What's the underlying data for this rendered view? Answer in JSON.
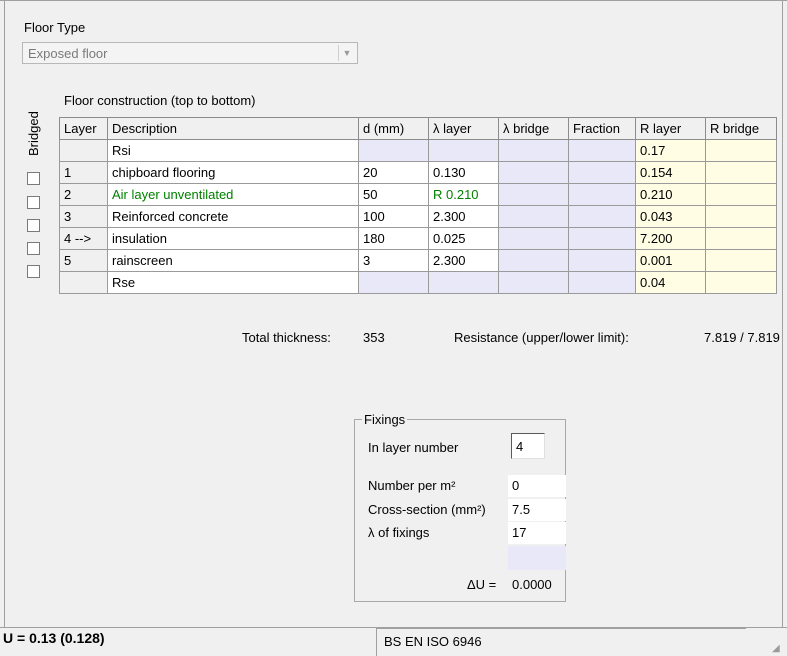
{
  "floor_type": {
    "label": "Floor Type",
    "value": "Exposed floor"
  },
  "construction": {
    "label": "Floor construction (top to bottom)",
    "bridged_label": "Bridged",
    "columns": [
      "Layer",
      "Description",
      "d (mm)",
      "λ layer",
      "λ bridge",
      "Fraction",
      "R layer",
      "R bridge"
    ],
    "rows": [
      {
        "layer": "",
        "description": "Rsi",
        "d": "",
        "lambda": "",
        "lambda_bridge": "",
        "fraction": "",
        "r_layer": "0.17",
        "r_bridge": ""
      },
      {
        "layer": "1",
        "description": "chipboard flooring",
        "d": "20",
        "lambda": "0.130",
        "lambda_bridge": "",
        "fraction": "",
        "r_layer": "0.154",
        "r_bridge": ""
      },
      {
        "layer": "2",
        "description": "Air layer unventilated",
        "d": "50",
        "lambda": "R 0.210",
        "lambda_bridge": "",
        "fraction": "",
        "r_layer": "0.210",
        "r_bridge": ""
      },
      {
        "layer": "3",
        "description": "Reinforced concrete",
        "d": "100",
        "lambda": "2.300",
        "lambda_bridge": "",
        "fraction": "",
        "r_layer": "0.043",
        "r_bridge": ""
      },
      {
        "layer": "4 -->",
        "description": "insulation",
        "d": "180",
        "lambda": "0.025",
        "lambda_bridge": "",
        "fraction": "",
        "r_layer": "7.200",
        "r_bridge": ""
      },
      {
        "layer": "5",
        "description": "rainscreen",
        "d": "3",
        "lambda": "2.300",
        "lambda_bridge": "",
        "fraction": "",
        "r_layer": "0.001",
        "r_bridge": ""
      },
      {
        "layer": "",
        "description": "Rse",
        "d": "",
        "lambda": "",
        "lambda_bridge": "",
        "fraction": "",
        "r_layer": "0.04",
        "r_bridge": ""
      }
    ],
    "highlight_color": "#008000"
  },
  "totals": {
    "thickness_label": "Total thickness:",
    "thickness_value": "353",
    "resistance_label": "Resistance (upper/lower limit):",
    "resistance_value": "7.819 / 7.819"
  },
  "fixings": {
    "title": "Fixings",
    "layer_number_label": "In layer number",
    "layer_number_value": "4",
    "number_per_m2_label": "Number per m²",
    "number_per_m2_value": "0",
    "cross_section_label": "Cross-section (mm²)",
    "cross_section_value": "7.5",
    "lambda_label": "λ  of fixings",
    "lambda_value": "17",
    "delta_u_label": "ΔU =",
    "delta_u_value": "0.0000"
  },
  "status": {
    "u_value": "U = 0.13  (0.128)",
    "standard": "BS EN ISO 6946"
  }
}
